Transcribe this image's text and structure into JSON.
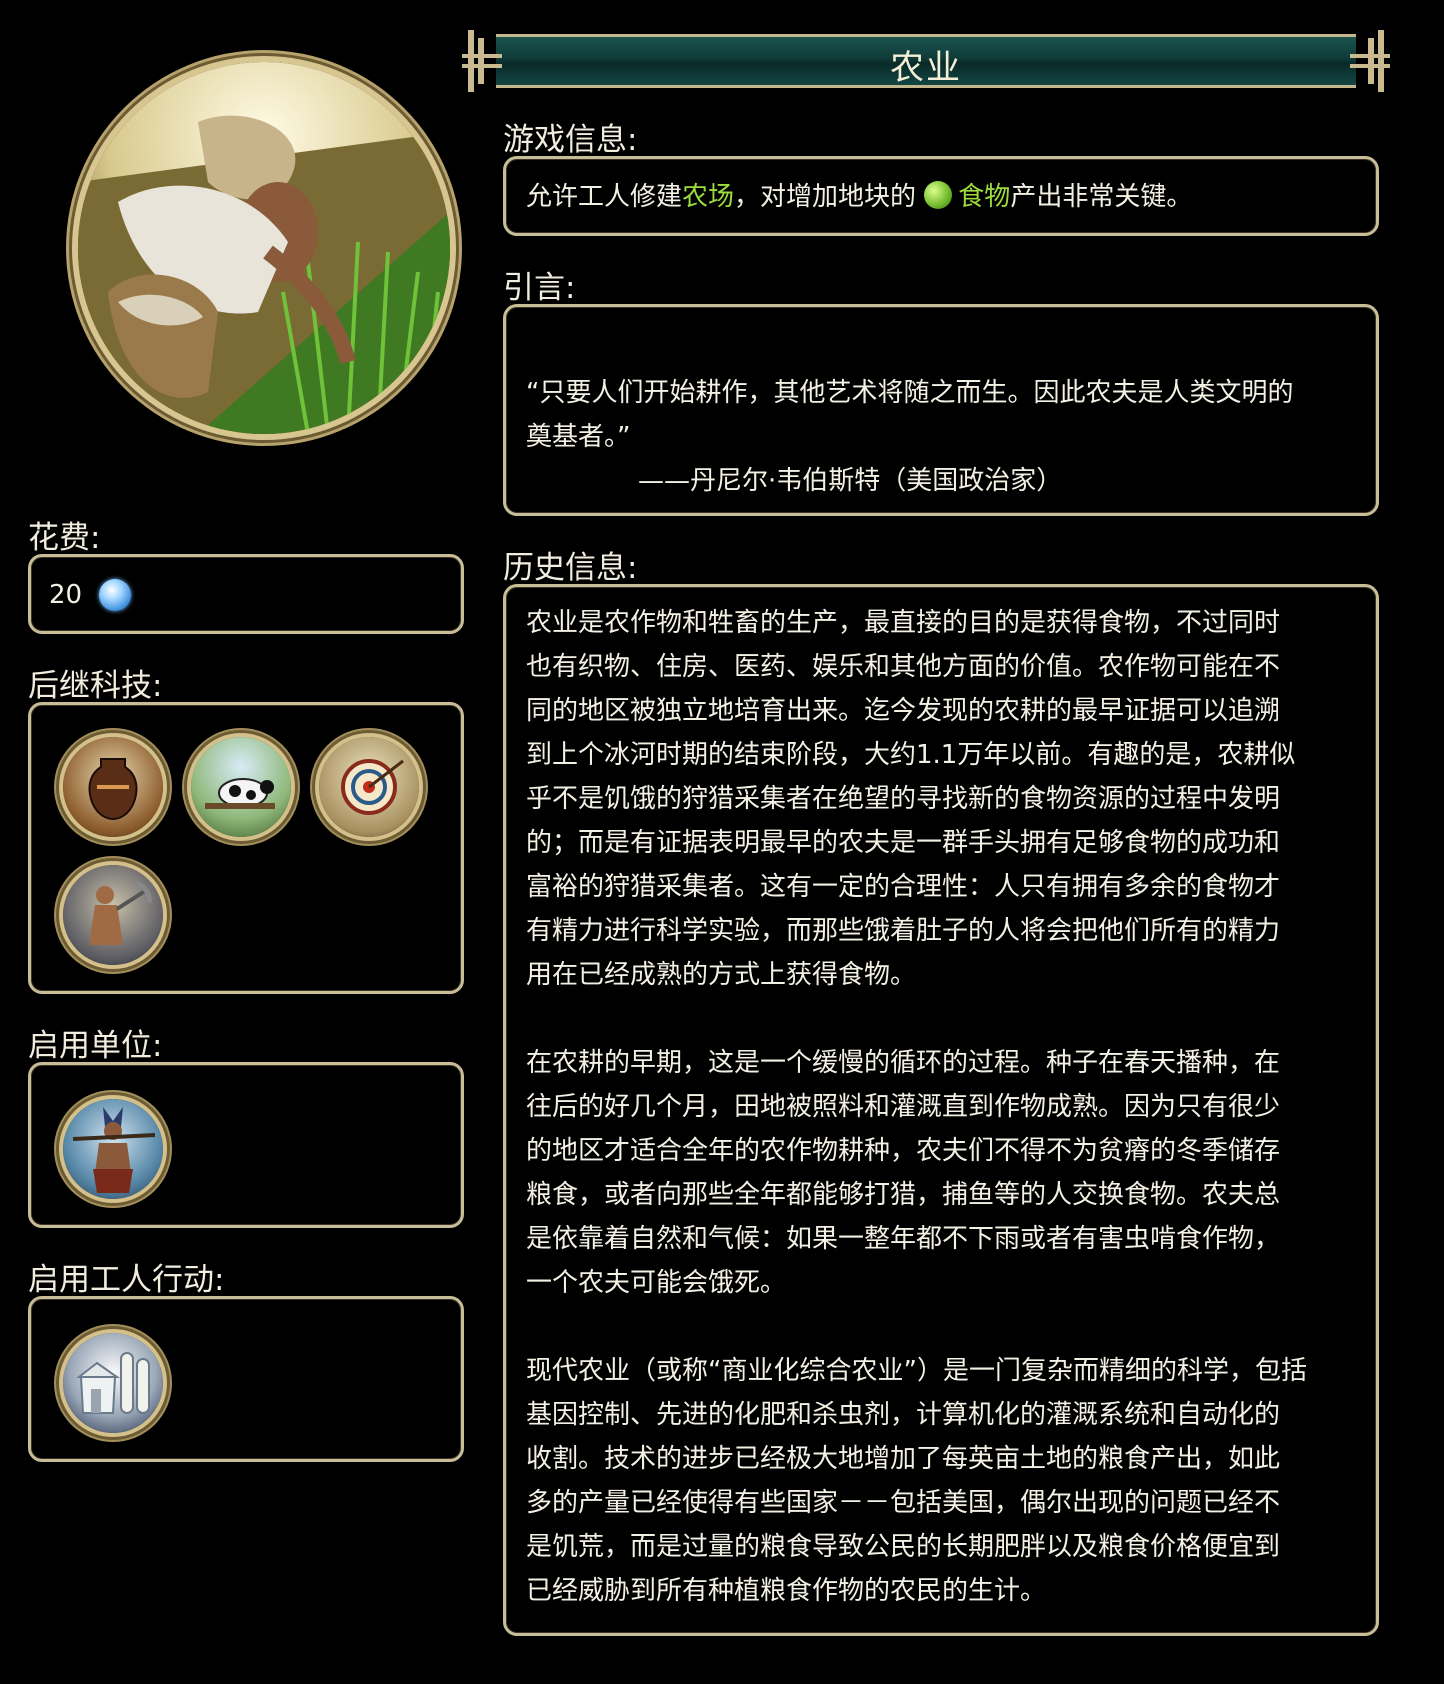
{
  "header": {
    "title": "农业"
  },
  "game_info": {
    "label": "游戏信息:",
    "text_before": "允许工人修建",
    "farm_link": "农场",
    "text_mid": "，对增加地块的 ",
    "food_link": "食物",
    "text_after": "产出非常关键。"
  },
  "quote": {
    "label": "引言:",
    "line1": "“只要人们开始耕作，其他艺术将随之而生。因此农夫是人类文明的",
    "line2": "奠基者。”",
    "attribution": "——丹尼尔·韦伯斯特（美国政治家）"
  },
  "history": {
    "label": "历史信息:",
    "para1_lines": [
      "农业是农作物和牲畜的生产，最直接的目的是获得食物，不过同时",
      "也有织物、住房、医药、娱乐和其他方面的价值。农作物可能在不",
      "同的地区被独立地培育出来。迄今发现的农耕的最早证据可以追溯",
      "到上个冰河时期的结束阶段，大约1.1万年以前。有趣的是，农耕似",
      "乎不是饥饿的狩猎采集者在绝望的寻找新的食物资源的过程中发明",
      "的；而是有证据表明最早的农夫是一群手头拥有足够食物的成功和",
      "富裕的狩猎采集者。这有一定的合理性：人只有拥有多余的食物才",
      "有精力进行科学实验，而那些饿着肚子的人将会把他们所有的精力",
      "用在已经成熟的方式上获得食物。"
    ],
    "para2_lines": [
      "在农耕的早期，这是一个缓慢的循环的过程。种子在春天播种，在",
      "往后的好几个月，田地被照料和灌溉直到作物成熟。因为只有很少",
      "的地区才适合全年的农作物耕种，农夫们不得不为贫瘠的冬季储存",
      "粮食，或者向那些全年都能够打猎，捕鱼等的人交换食物。农夫总",
      "是依靠着自然和气候：如果一整年都不下雨或者有害虫啃食作物，",
      "一个农夫可能会饿死。"
    ],
    "para3_lines": [
      "现代农业（或称“商业化综合农业”）是一门复杂而精细的科学，包括",
      "基因控制、先进的化肥和杀虫剂，计算机化的灌溉系统和自动化的",
      "收割。技术的进步已经极大地增加了每英亩土地的粮食产出，如此",
      "多的产量已经使得有些国家－－包括美国，偶尔出现的问题已经不",
      "是饥荒，而是过量的粮食导致公民的长期肥胖以及粮食价格便宜到",
      "已经威胁到所有种植粮食作物的农民的生计。"
    ]
  },
  "cost": {
    "label": "花费:",
    "value": "20",
    "icon": "science-icon"
  },
  "successors": {
    "label": "后继科技:",
    "items": [
      {
        "icon": "pottery-tech-icon"
      },
      {
        "icon": "animal-husbandry-tech-icon"
      },
      {
        "icon": "archery-tech-icon"
      },
      {
        "icon": "mining-tech-icon"
      }
    ]
  },
  "units": {
    "label": "启用单位:",
    "items": [
      {
        "icon": "warrior-unit-icon"
      }
    ]
  },
  "worker_actions": {
    "label": "启用工人行动:",
    "items": [
      {
        "icon": "farm-improvement-icon"
      }
    ]
  },
  "colors": {
    "frame": "#c8bd97",
    "banner": "#0f3a37",
    "link_green": "#9cdc3c",
    "background": "#000000"
  }
}
